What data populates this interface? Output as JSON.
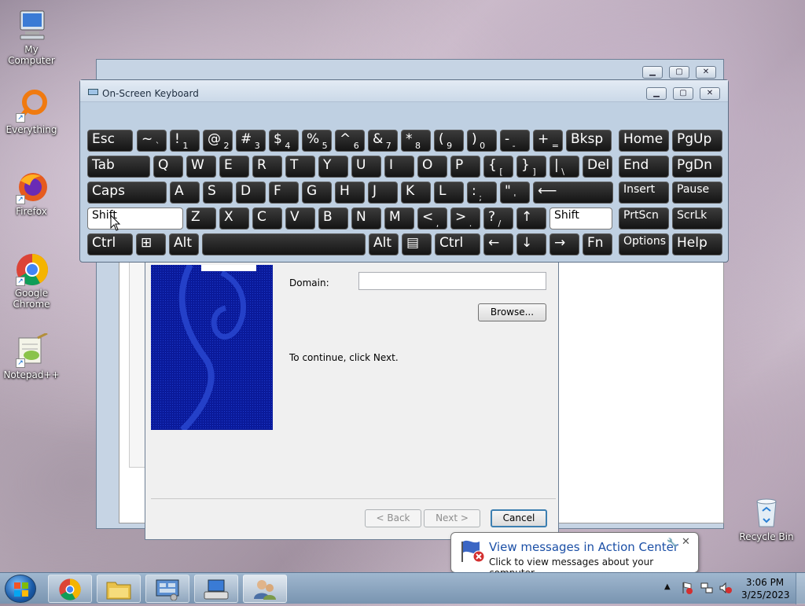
{
  "desktop": {
    "icons": [
      {
        "label": "My Computer",
        "icon": "computer-icon"
      },
      {
        "label": "Everything",
        "icon": "everything-icon"
      },
      {
        "label": "Firefox",
        "icon": "firefox-icon"
      },
      {
        "label": "Google Chrome",
        "icon": "chrome-icon"
      },
      {
        "label": "Notepad++",
        "icon": "notepad-plus-plus-icon"
      },
      {
        "label": "Recycle Bin",
        "icon": "recycle-bin-icon"
      }
    ]
  },
  "osk": {
    "title": "On-Screen Keyboard",
    "rows": [
      [
        {
          "main": "Esc"
        },
        {
          "main": "~",
          "sub": "`"
        },
        {
          "main": "!",
          "sub": "1"
        },
        {
          "main": "@",
          "sub": "2"
        },
        {
          "main": "#",
          "sub": "3"
        },
        {
          "main": "$",
          "sub": "4"
        },
        {
          "main": "%",
          "sub": "5"
        },
        {
          "main": "^",
          "sub": "6"
        },
        {
          "main": "&",
          "sub": "7"
        },
        {
          "main": "*",
          "sub": "8"
        },
        {
          "main": "(",
          "sub": "9"
        },
        {
          "main": ")",
          "sub": "0"
        },
        {
          "main": "-",
          "sub": "-"
        },
        {
          "main": "+",
          "sub": "="
        },
        {
          "main": "Bksp"
        },
        {
          "main": "Home"
        },
        {
          "main": "PgUp"
        }
      ],
      [
        {
          "main": "Tab"
        },
        {
          "main": "Q"
        },
        {
          "main": "W"
        },
        {
          "main": "E"
        },
        {
          "main": "R"
        },
        {
          "main": "T"
        },
        {
          "main": "Y"
        },
        {
          "main": "U"
        },
        {
          "main": "I"
        },
        {
          "main": "O"
        },
        {
          "main": "P"
        },
        {
          "main": "{",
          "sub": "["
        },
        {
          "main": "}",
          "sub": "]"
        },
        {
          "main": "|",
          "sub": "\\"
        },
        {
          "main": "Del"
        },
        {
          "main": "End"
        },
        {
          "main": "PgDn"
        }
      ],
      [
        {
          "main": "Caps"
        },
        {
          "main": "A"
        },
        {
          "main": "S"
        },
        {
          "main": "D"
        },
        {
          "main": "F"
        },
        {
          "main": "G"
        },
        {
          "main": "H"
        },
        {
          "main": "J"
        },
        {
          "main": "K"
        },
        {
          "main": "L"
        },
        {
          "main": ":",
          "sub": ";"
        },
        {
          "main": "\"",
          "sub": "'"
        },
        {
          "main": "⟵"
        },
        {
          "main": "Insert"
        },
        {
          "main": "Pause"
        }
      ],
      [
        {
          "main": "Shift"
        },
        {
          "main": "Z"
        },
        {
          "main": "X"
        },
        {
          "main": "C"
        },
        {
          "main": "V"
        },
        {
          "main": "B"
        },
        {
          "main": "N"
        },
        {
          "main": "M"
        },
        {
          "main": "<",
          "sub": ","
        },
        {
          "main": ">",
          "sub": "."
        },
        {
          "main": "?",
          "sub": "/"
        },
        {
          "main": "↑"
        },
        {
          "main": "Shift"
        },
        {
          "main": "PrtScn"
        },
        {
          "main": "ScrLk"
        }
      ],
      [
        {
          "main": "Ctrl"
        },
        {
          "main": "⊞"
        },
        {
          "main": "Alt"
        },
        {
          "main": ""
        },
        {
          "main": "Alt"
        },
        {
          "main": "▤"
        },
        {
          "main": "Ctrl"
        },
        {
          "main": "←"
        },
        {
          "main": "↓"
        },
        {
          "main": "→"
        },
        {
          "main": "Fn"
        },
        {
          "main": "Options"
        },
        {
          "main": "Help"
        }
      ]
    ]
  },
  "wizard": {
    "domain_label": "Domain:",
    "domain_value": "",
    "browse_label": "Browse...",
    "continue_text": "To continue, click Next.",
    "back_label": "< Back",
    "next_label": "Next >",
    "cancel_label": "Cancel"
  },
  "notification": {
    "title": "View messages in Action Center",
    "body": "Click to view messages about your computer."
  },
  "tray": {
    "time": "3:06 PM",
    "date": "3/25/2023"
  }
}
